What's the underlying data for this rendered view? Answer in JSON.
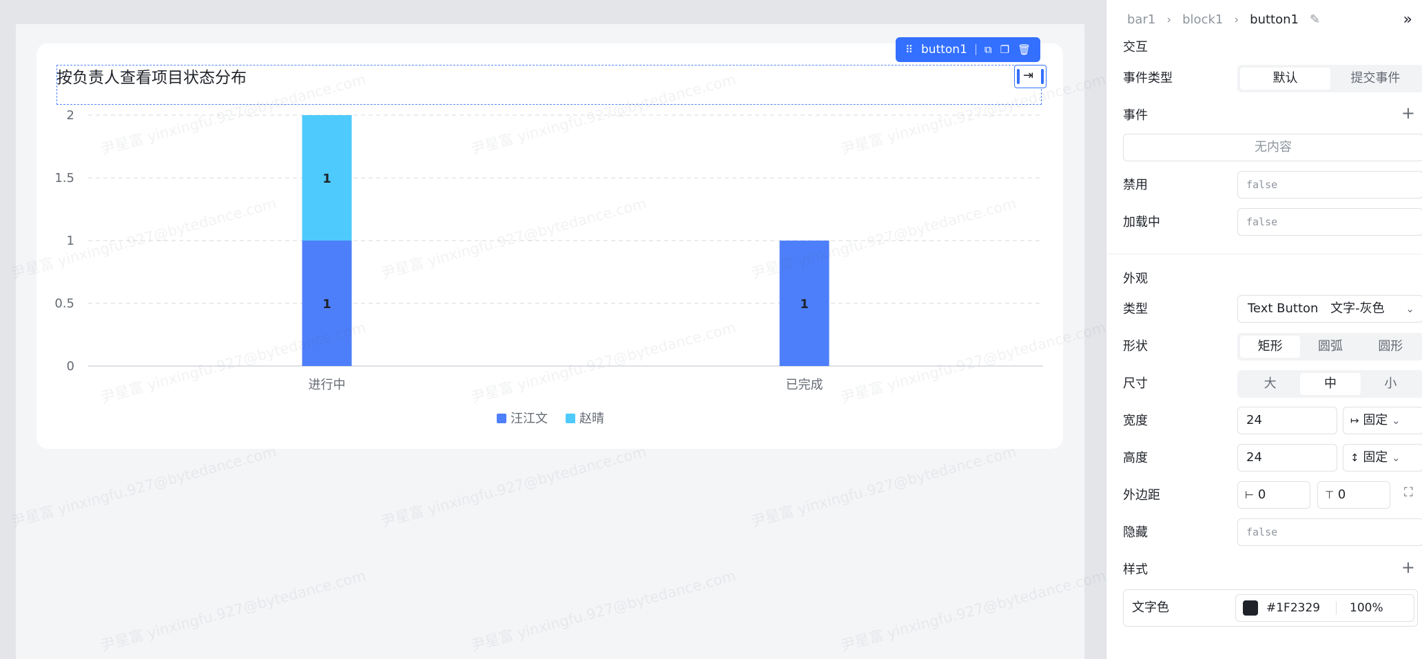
{
  "toolbar": {
    "name": "button1"
  },
  "chart_data": {
    "type": "bar",
    "stacked": true,
    "title": "按负责人查看项目状态分布",
    "categories": [
      "进行中",
      "已完成"
    ],
    "series": [
      {
        "name": "汪江文",
        "color": "#4e7ffa",
        "values": [
          1,
          1
        ]
      },
      {
        "name": "赵晴",
        "color": "#4ecafd",
        "values": [
          1,
          0
        ]
      }
    ],
    "ylim": [
      0,
      2
    ],
    "yticks": [
      "0",
      "0.5",
      "1",
      "1.5",
      "2"
    ],
    "grid": true,
    "legend": "bottom"
  },
  "watermark": "尹星富 yinxingfu.927@bytedance.com",
  "panel": {
    "breadcrumb": [
      "bar1",
      "block1",
      "button1"
    ],
    "interaction": {
      "title": "交互",
      "event_type": {
        "label": "事件类型",
        "options": [
          "默认",
          "提交事件"
        ],
        "selected": 0
      },
      "events": {
        "label": "事件",
        "empty": "无内容"
      },
      "disabled": {
        "label": "禁用",
        "value": "false"
      },
      "loading": {
        "label": "加载中",
        "value": "false"
      }
    },
    "appearance": {
      "title": "外观",
      "type": {
        "label": "类型",
        "value": "Text Button",
        "sub": "文字-灰色"
      },
      "shape": {
        "label": "形状",
        "options": [
          "矩形",
          "圆弧",
          "圆形"
        ],
        "selected": 0
      },
      "size": {
        "label": "尺寸",
        "options": [
          "大",
          "中",
          "小"
        ],
        "selected": 1
      },
      "width": {
        "label": "宽度",
        "value": "24",
        "mode": "固定"
      },
      "height": {
        "label": "高度",
        "value": "24",
        "mode": "固定"
      },
      "margin": {
        "label": "外边距",
        "h": "0",
        "v": "0"
      },
      "hidden": {
        "label": "隐藏",
        "value": "false"
      }
    },
    "style": {
      "title": "样式",
      "text_color": {
        "label": "文字色",
        "swatch": "#1F2329",
        "hex": "#1F2329",
        "opacity": "100%"
      }
    }
  }
}
